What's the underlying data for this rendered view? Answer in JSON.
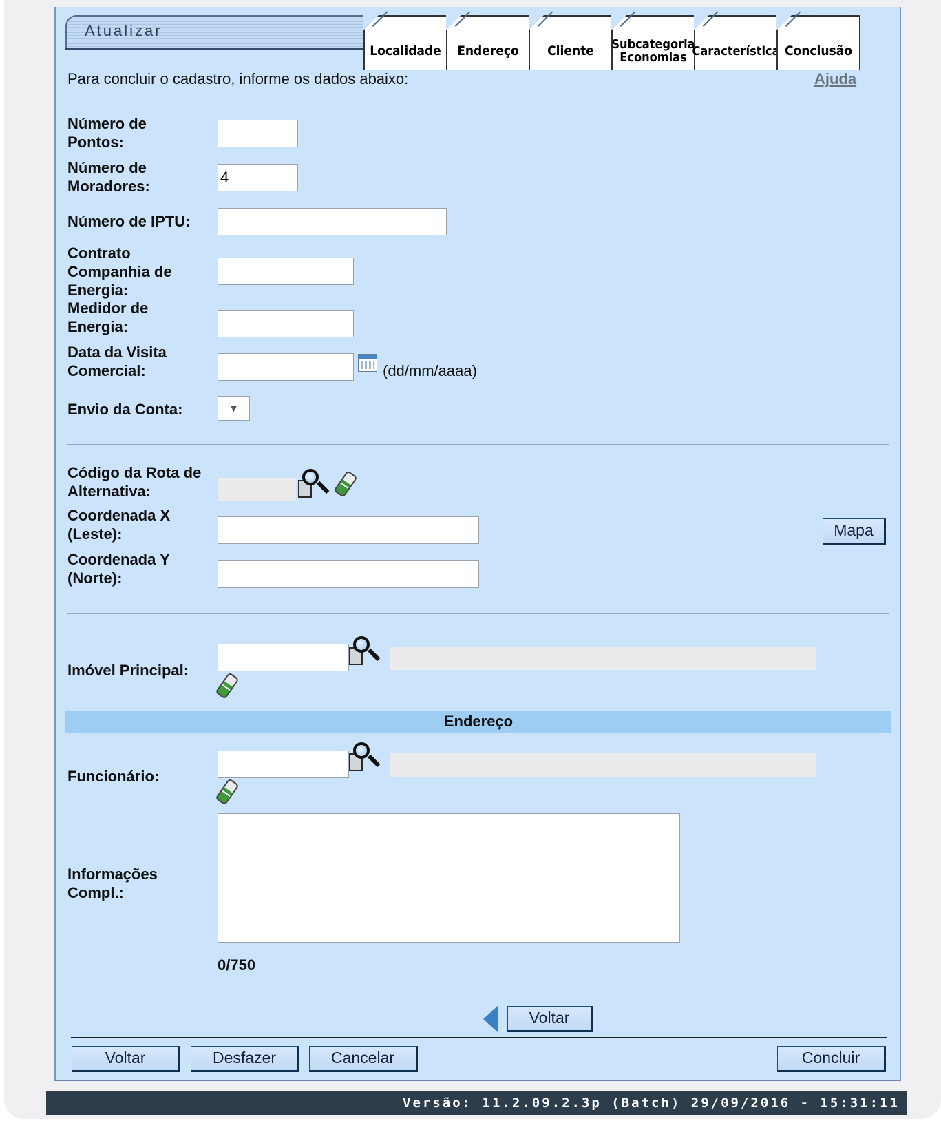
{
  "header": {
    "title": "Atualizar",
    "tabs": [
      {
        "label": "Localidade"
      },
      {
        "label": "Endereço"
      },
      {
        "label": "Cliente"
      },
      {
        "label_line1": "Subcategoria",
        "label_line2": "Economias"
      },
      {
        "label": "Característica"
      },
      {
        "label": "Conclusão"
      }
    ]
  },
  "intro": {
    "text": "Para concluir o cadastro, informe os dados abaixo:",
    "help_link": "Ajuda"
  },
  "form": {
    "pontos": {
      "label_line1": "Número de",
      "label_line2": "Pontos:",
      "value": ""
    },
    "moradores": {
      "label_line1": "Número de",
      "label_line2": "Moradores:",
      "value": "4"
    },
    "iptu": {
      "label": "Número de IPTU:",
      "value": ""
    },
    "contrato": {
      "label_line1": "Contrato",
      "label_line2": "Companhia de",
      "label_line3": "Energia:",
      "value": ""
    },
    "medidor": {
      "label_line1": "Medidor de",
      "label_line2": "Energia:",
      "value": ""
    },
    "data_visita": {
      "label_line1": "Data da Visita",
      "label_line2": "Comercial:",
      "value": "",
      "hint": "(dd/mm/aaaa)"
    },
    "envio_conta": {
      "label": "Envio da Conta:",
      "selected": ""
    },
    "rota": {
      "label_line1": "Código da Rota de",
      "label_line2": "Alternativa:",
      "value": ""
    },
    "coord_x": {
      "label_line1": "Coordenada X",
      "label_line2": "(Leste):",
      "value": ""
    },
    "coord_y": {
      "label_line1": "Coordenada Y",
      "label_line2": "(Norte):",
      "value": ""
    },
    "mapa_button": "Mapa",
    "imovel_principal": {
      "label": "Imóvel Principal:",
      "value": "",
      "description": ""
    },
    "section_endereco": "Endereço",
    "funcionario": {
      "label": "Funcionário:",
      "value": "",
      "description": ""
    },
    "info_compl": {
      "label_line1": "Informações",
      "label_line2": "Compl.:",
      "value": "",
      "counter": "0/750"
    }
  },
  "nav": {
    "voltar_label": "Voltar"
  },
  "actions": {
    "voltar": "Voltar",
    "desfazer": "Desfazer",
    "cancelar": "Cancelar",
    "concluir": "Concluir"
  },
  "footer": {
    "version": "Versão: 11.2.09.2.3p (Batch) 29/09/2016 - 15:31:11"
  },
  "colors": {
    "panel_bg": "#cce4fb",
    "section_bar": "#9dcdf2",
    "footer_bg": "#2e3d4c"
  },
  "icons": [
    "chat-icon",
    "calendar-icon",
    "search-icon",
    "eraser-icon",
    "back-arrow-icon",
    "dropdown-arrow-icon"
  ]
}
